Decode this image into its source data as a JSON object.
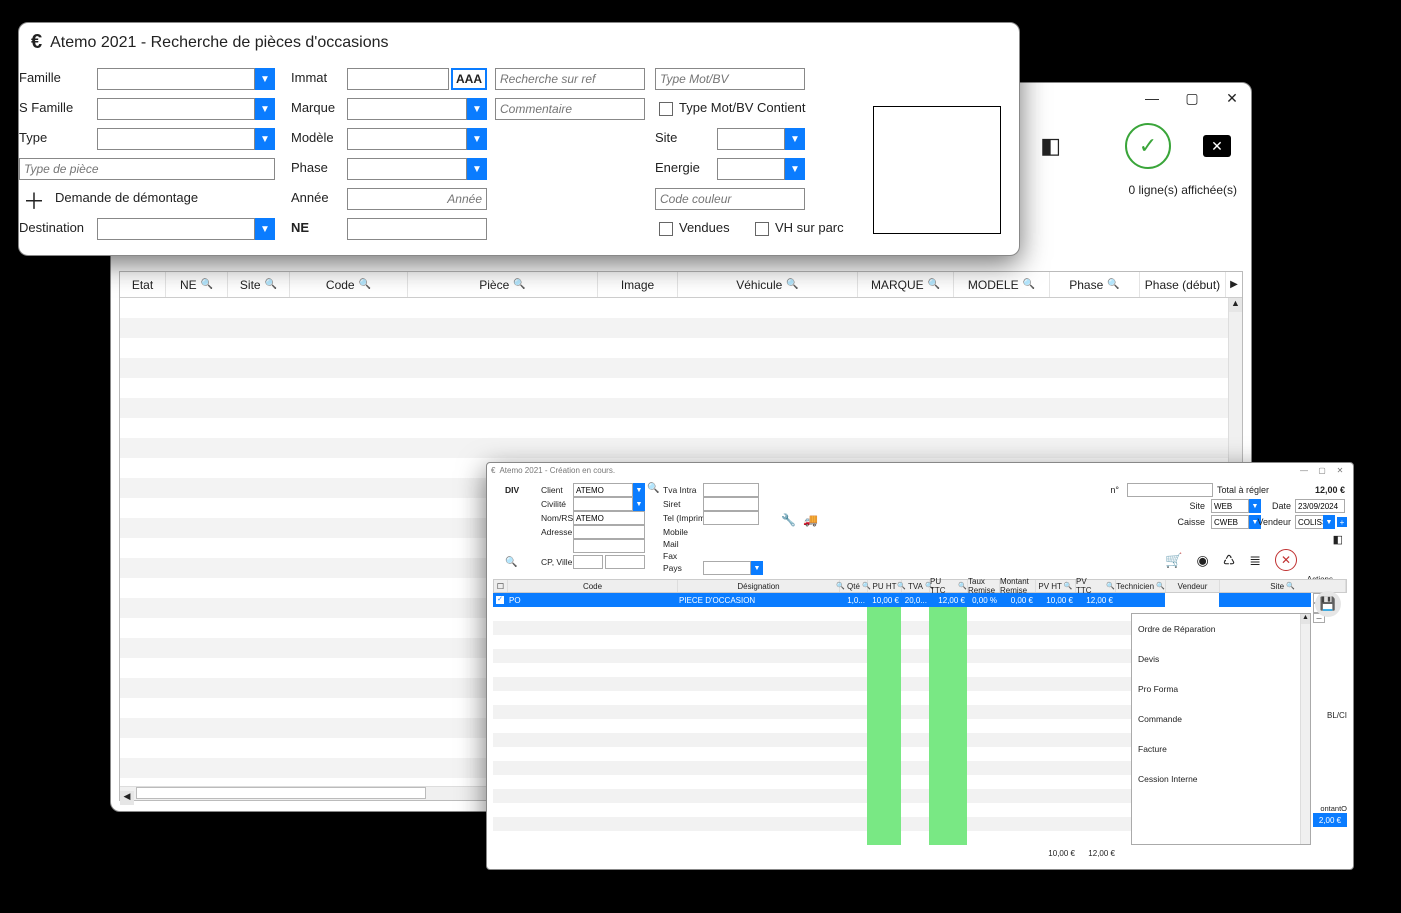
{
  "back": {
    "status": "0 ligne(s) affichée(s)",
    "columns": [
      "Etat",
      "NE",
      "Site",
      "Code",
      "Pièce",
      "Image",
      "Véhicule",
      "MARQUE",
      "MODELE",
      "Phase",
      "Phase (début)"
    ]
  },
  "search": {
    "title": "Atemo 2021 - Recherche de pièces d'occasions",
    "labels": {
      "famille": "Famille",
      "sfamille": "S Famille",
      "type": "Type",
      "type_piece_ph": "Type de pièce",
      "demande": "Demande de démontage",
      "destination": "Destination",
      "immat": "Immat",
      "marque": "Marque",
      "modele": "Modèle",
      "phase": "Phase",
      "annee": "Année",
      "annee_ph": "Année",
      "ne": "NE",
      "ref_ph": "Recherche sur ref",
      "comment_ph": "Commentaire",
      "typemot_ph": "Type Mot/BV",
      "typemot_chk": "Type Mot/BV Contient",
      "site": "Site",
      "energie": "Energie",
      "code_couleur_ph": "Code couleur",
      "vendues": "Vendues",
      "vh_parc": "VH sur parc",
      "aaa": "AAA"
    }
  },
  "sale": {
    "title": "Atemo 2021 - Création en cours.",
    "div": "DIV",
    "labels": {
      "client": "Client",
      "civilite": "Civilité",
      "nomrs": "Nom/RS",
      "adresse": "Adresse",
      "cpville": "CP, Ville",
      "tva": "Tva Intra",
      "siret": "Siret",
      "telimp": "Tel (Imprimé)",
      "mobile": "Mobile",
      "mail": "Mail",
      "fax": "Fax",
      "pays": "Pays",
      "num": "n°",
      "total": "Total à régler",
      "date": "Date",
      "site": "Site",
      "caisse": "Caisse",
      "vendeur": "Vendeur",
      "actions": "Actions"
    },
    "values": {
      "client": "ATEMO",
      "nomrs": "ATEMO",
      "total": "12,00 €",
      "date": "23/09/2024",
      "site": "WEB",
      "caisse": "CWEB",
      "vendeur": "COLISSIMO"
    },
    "grid": {
      "cols": [
        "",
        "Code",
        "Désignation",
        "Qté",
        "PU HT",
        "TVA",
        "PU TTC",
        "Taux Remise",
        "Montant Remise",
        "PV HT",
        "PV TTC",
        "Technicien",
        "Vendeur",
        "Site"
      ],
      "row": {
        "code": "PO",
        "designation": "PIECE D'OCCASION",
        "qte": "1,0...",
        "puht": "10,00 €",
        "tva": "20,0...",
        "puttc": "12,00 €",
        "tauxrem": "0,00 %",
        "montrem": "0,00 €",
        "pvht": "10,00 €",
        "pvttc": "12,00 €"
      },
      "foot": {
        "pvht": "10,00 €",
        "pvttc": "12,00 €"
      }
    },
    "menu": [
      "Ordre de Réparation",
      "Devis",
      "Pro Forma",
      "Commande",
      "Facture",
      "Cession Interne"
    ],
    "side": {
      "blci": "BL/CI",
      "montant": "ontantO",
      "total_badge": "2,00 €"
    }
  }
}
